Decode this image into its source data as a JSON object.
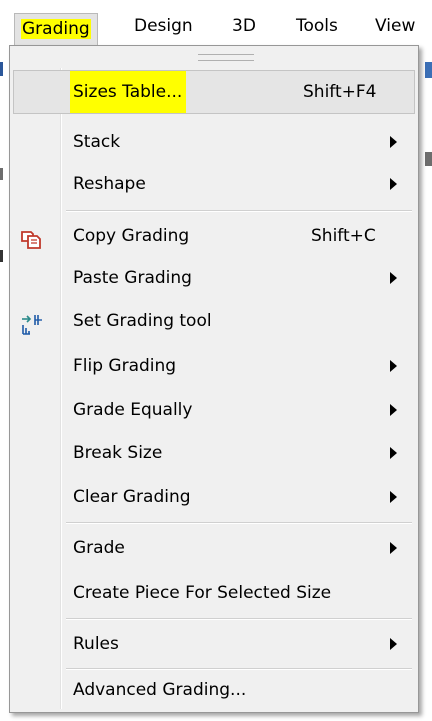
{
  "menubar": {
    "items": [
      {
        "label": "Grading"
      },
      {
        "label": "Design"
      },
      {
        "label": "3D"
      },
      {
        "label": "Tools"
      },
      {
        "label": "View"
      }
    ]
  },
  "menu": {
    "items": [
      {
        "label": "Sizes Table...",
        "shortcut": "Shift+F4"
      },
      {
        "label": "Stack"
      },
      {
        "label": "Reshape"
      },
      {
        "label": "Copy Grading",
        "shortcut": "Shift+C",
        "icon": "copy-grading-icon"
      },
      {
        "label": "Paste Grading"
      },
      {
        "label": "Set Grading tool",
        "icon": "grading-tool-icon"
      },
      {
        "label": "Flip Grading"
      },
      {
        "label": "Grade Equally"
      },
      {
        "label": "Break Size"
      },
      {
        "label": "Clear Grading"
      },
      {
        "label": "Grade"
      },
      {
        "label": "Create Piece For Selected Size"
      },
      {
        "label": "Rules"
      },
      {
        "label": "Advanced Grading..."
      }
    ]
  },
  "colors": {
    "highlight": "#ffff00",
    "menu_background": "#f0f0f0",
    "hover_background": "#e5e5e5",
    "icon_red": "#c0392b",
    "icon_blue": "#1e5aa8",
    "icon_teal": "#2a8a8a"
  }
}
